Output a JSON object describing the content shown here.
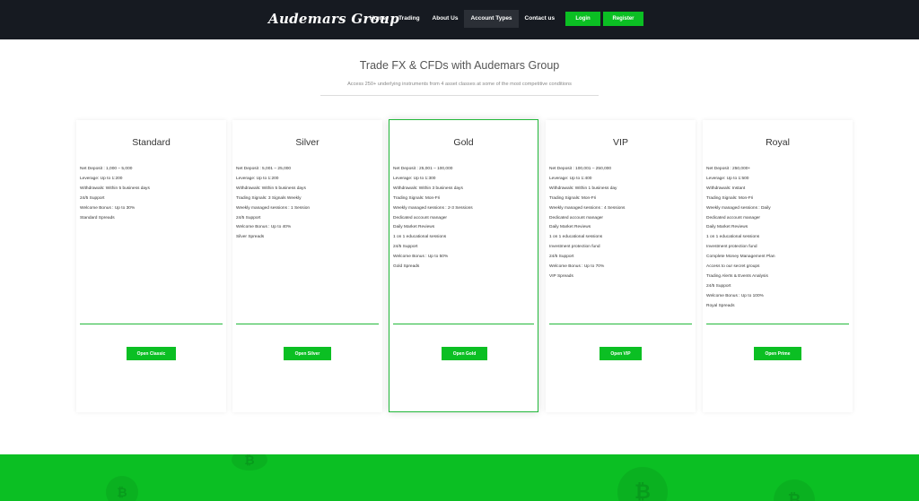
{
  "header": {
    "logo": "Audemars Group",
    "nav": [
      {
        "label": "Home",
        "active": false
      },
      {
        "label": "Trading",
        "active": false
      },
      {
        "label": "About Us",
        "active": false
      },
      {
        "label": "Account Types",
        "active": true
      },
      {
        "label": "Contact us",
        "active": false
      }
    ],
    "login_label": "Login",
    "register_label": "Register"
  },
  "hero": {
    "title": "Trade FX & CFDs with Audemars Group",
    "subtitle": "Access 250+ underlying instruments from 4 asset classes at some of the most competitive conditions"
  },
  "cards": [
    {
      "title": "Standard",
      "features": [
        "Net Deposit : 1,000 – 5,000",
        "Leverage: Up to 1:200",
        "Withdrawals: Within 5 business days",
        "24/5 Support",
        "Welcome Bonus : Up to 30%",
        "Standard Spreads"
      ],
      "button": "Open Classic"
    },
    {
      "title": "Silver",
      "features": [
        "Net Deposit : 5,001 – 25,000",
        "Leverage: Up to 1:200",
        "Withdrawals: Within 5 business days",
        "Trading Signals: 3 Signals Weekly",
        "Weekly managed sessions : 1 Session",
        "24/5 Support",
        "Welcome Bonus : Up to 40%",
        "Silver Spreads"
      ],
      "button": "Open Silver"
    },
    {
      "title": "Gold",
      "features": [
        "Net Deposit : 25,001 – 100,000",
        "Leverage: Up to 1:300",
        "Withdrawals: Within 3 business days",
        "Trading Signals: Mon-Fri",
        "Weekly managed sessions : 2-3 Sessions",
        "Dedicated account manager",
        "Daily Market Reviews",
        "1 on 1 educational sessions",
        "24/5 Support",
        "Welcome Bonus : Up to 50%",
        "Gold Spreads"
      ],
      "button": "Open Gold"
    },
    {
      "title": "VIP",
      "features": [
        "Net Deposit : 100,001 – 250,000",
        "Leverage: Up to 1:400",
        "Withdrawals: Within 1 business day",
        "Trading Signals: Mon-Fri",
        "Weekly managed sessions : 4 Sessions",
        "Dedicated account manager",
        "Daily Market Reviews",
        "1 on 1 educational sessions",
        "Investment protection fund",
        "24/5 Support",
        "Welcome Bonus : Up to 70%",
        "VIP Spreads"
      ],
      "button": "Open VIP"
    },
    {
      "title": "Royal",
      "features": [
        "Net Deposit : 250,000+",
        "Leverage: Up to 1:500",
        "Withdrawals: Instant",
        "Trading Signals: Mon-Fri",
        "Weekly managed sessions : Daily",
        "Dedicated account manager",
        "Daily Market Reviews",
        "1 on 1 educational sessions",
        "Investment protection fund",
        "Complete Money Management Plan",
        "Access to our secret groups",
        "Trading Alerts & Events Analysis",
        "24/5 Support",
        "Welcome Bonus : Up to 100%",
        "Royal Spreads"
      ],
      "button": "Open Prime"
    }
  ],
  "colors": {
    "header_bg": "#161a21",
    "accent_green": "#0bbf23",
    "featured_border": "#22b83a"
  },
  "icons": {
    "coin": "bitcoin-icon"
  }
}
